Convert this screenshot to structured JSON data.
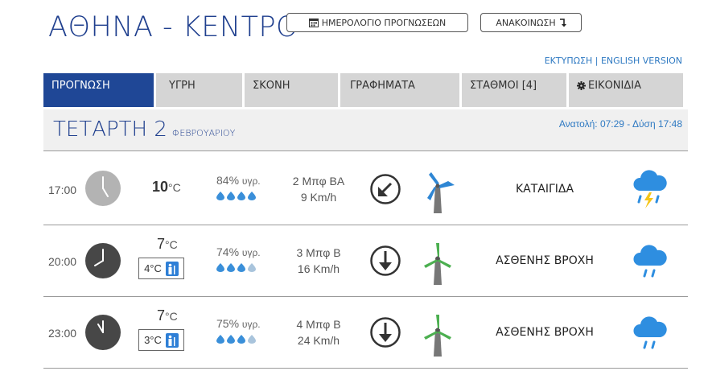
{
  "header": {
    "city": "ΑΘΗΝΑ - ΚΕΝΤΡΟ",
    "calendar_button": "ΗΜΕΡΟΛΟΓΙΟ ΠΡΟΓΝΩΣΕΩΝ",
    "announcement_button": "ΑΝΑΚΟΙΝΩΣΗ",
    "print_link": "ΕΚΤΥΠΩΣΗ",
    "separator": " | ",
    "english_link": "ENGLISH VERSION"
  },
  "tabs": [
    {
      "label": "ΠΡΟΓΝΩΣΗ",
      "active": true
    },
    {
      "label": "ΥΓΡΗ",
      "active": false
    },
    {
      "label": "ΣΚΟΝΗ",
      "active": false
    },
    {
      "label": "ΓΡΑΦΗΜΑΤΑ",
      "active": false
    },
    {
      "label": "ΣΤΑΘΜΟΙ [4]",
      "active": false
    },
    {
      "label": "ΕΙΚΟΝΙΔΙΑ",
      "active": false,
      "icon": "gear-icon"
    }
  ],
  "day": {
    "name": "ΤΕΤΑΡΤΗ 2",
    "month": "ΦΕΒΡΟΥΑΡΙΟΥ",
    "sun": "Ανατολή: 07:29 - Δύση 17:48"
  },
  "rows": [
    {
      "time": "17:00",
      "clock": "gray",
      "temp": "10",
      "unit": "°C",
      "feels": "",
      "humidity": "84%",
      "humidity_unit": "υγρ.",
      "drops_filled": 4,
      "wind_beaufort": "2 Μπφ ΒΑ",
      "wind_kmh": "9 Km/h",
      "wind_arrow": "south-west",
      "turbine": "blue",
      "condition": "ΚΑΤΑΙΓΙΔΑ",
      "weather_icon": "storm-cloud-icon"
    },
    {
      "time": "20:00",
      "clock": "dark",
      "temp": "7",
      "unit": "°C",
      "feels": "4°C",
      "humidity": "74%",
      "humidity_unit": "υγρ.",
      "drops_filled": 3,
      "wind_beaufort": "3 Μπφ Β",
      "wind_kmh": "16 Km/h",
      "wind_arrow": "south",
      "turbine": "green",
      "condition": "ΑΣΘΕΝΗΣ ΒΡΟΧΗ",
      "weather_icon": "rain-cloud-icon"
    },
    {
      "time": "23:00",
      "clock": "dark",
      "temp": "7",
      "unit": "°C",
      "feels": "3°C",
      "humidity": "75%",
      "humidity_unit": "υγρ.",
      "drops_filled": 3,
      "wind_beaufort": "4 Μπφ Β",
      "wind_kmh": "24 Km/h",
      "wind_arrow": "south",
      "turbine": "green",
      "condition": "ΑΣΘΕΝΗΣ ΒΡΟΧΗ",
      "weather_icon": "rain-cloud-icon"
    }
  ],
  "colors": {
    "brand": "#1f3f8e",
    "active_tab": "#1f4796",
    "link": "#2e79c2",
    "drop": "#3a8fd9",
    "drop_empty": "#a9c4dc",
    "turbine_blue": "#2e86d4",
    "turbine_green": "#4caf50"
  }
}
